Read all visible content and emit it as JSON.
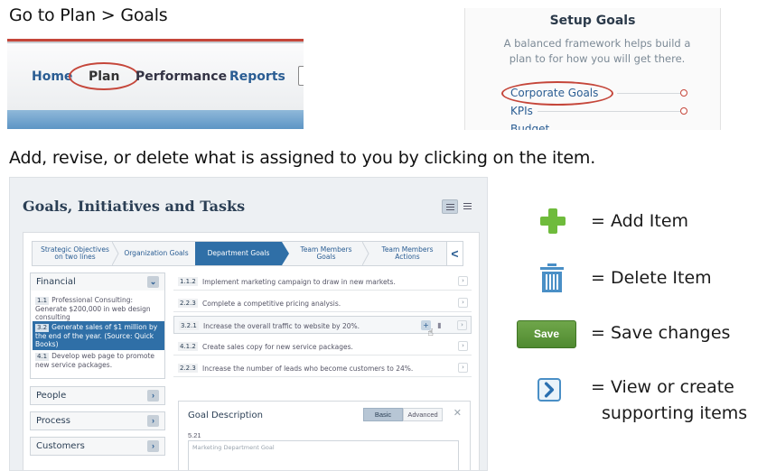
{
  "headings": {
    "step1": "Go to Plan > Goals",
    "step2": "Add, revise, or delete what is assigned to you by clicking on the item."
  },
  "nav": {
    "items": [
      "Home",
      "Plan",
      "Performance",
      "Reports"
    ]
  },
  "setup": {
    "title": "Setup Goals",
    "description": "A balanced framework helps build a plan to for how you will get there.",
    "items": [
      "Corporate Goals",
      "KPIs",
      "Budget"
    ]
  },
  "app": {
    "title": "Goals, Initiatives and Tasks",
    "crumbs": [
      "Strategic Objectives on two lines",
      "Organization Goals",
      "Department Goals",
      "Team Members Goals",
      "Team Members Actions"
    ],
    "crumb_nav": "<",
    "accordion": {
      "financial": "Financial",
      "people": "People",
      "process": "Process",
      "customers": "Customers"
    },
    "financial_items": [
      {
        "num": "1.1",
        "text": "Professional Consulting: Generate $200,000 in web design consulting"
      },
      {
        "num": "3.2",
        "text": "Generate sales of $1 million by the end of the year. (Source: Quick Books)"
      },
      {
        "num": "4.1",
        "text": "Develop web page to promote new service packages."
      }
    ],
    "goals": [
      {
        "num": "1.1.2",
        "text": "Implement marketing campaign to draw in new markets."
      },
      {
        "num": "2.2.3",
        "text": "Complete a competitive pricing analysis."
      },
      {
        "num": "3.2.1",
        "text": "Increase the overall traffic to website by 20%."
      },
      {
        "num": "4.1.2",
        "text": "Create sales copy for new service packages."
      },
      {
        "num": "2.2.3",
        "text": "Increase the number of leads who become customers to 24%."
      }
    ],
    "description_card": {
      "title": "Goal Description",
      "tab_basic": "Basic",
      "tab_advanced": "Advanced",
      "number": "5.21",
      "placeholder": "Marketing Department Goal"
    }
  },
  "legend": {
    "add": "= Add Item",
    "delete": "= Delete Item",
    "save_button": "Save",
    "save": "= Save changes",
    "view_line1": "= View or create",
    "view_line2": "supporting items"
  },
  "colors": {
    "accent_red": "#c5463a",
    "link_blue": "#2a5d93",
    "active_blue": "#2f6fa7",
    "add_green": "#6fbb3c",
    "save_green": "#5a9a3a"
  },
  "icons": [
    "plus-icon",
    "trash-icon",
    "chevron-right-icon",
    "close-icon",
    "list-view-icon"
  ]
}
